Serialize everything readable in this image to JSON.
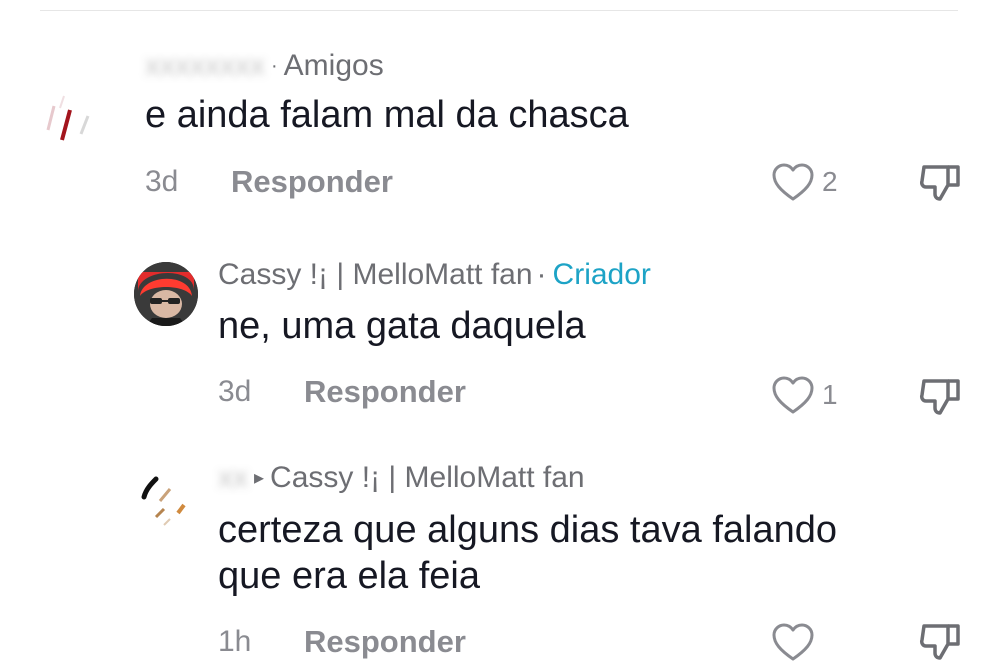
{
  "comments": [
    {
      "username": "Amigos",
      "text": "e ainda falam mal da chasca",
      "timestamp": "3d",
      "reply_label": "Responder",
      "like_count": "2"
    },
    {
      "username": "Cassy !¡ | MelloMatt fan",
      "separator": "·",
      "badge": "Criador",
      "text": "ne, uma gata daquela",
      "timestamp": "3d",
      "reply_label": "Responder",
      "like_count": "1"
    },
    {
      "reply_to": "Cassy !¡ | MelloMatt fan",
      "text": "certeza que alguns dias tava falando\nque era ela feia",
      "timestamp": "1h",
      "reply_label": "Responder",
      "like_count": ""
    }
  ],
  "icons": {
    "like": "heart-outline-icon",
    "dislike": "thumbs-down-icon"
  },
  "colors": {
    "creator_badge": "#1da3c6",
    "muted": "#8a8b91",
    "text": "#161823"
  }
}
